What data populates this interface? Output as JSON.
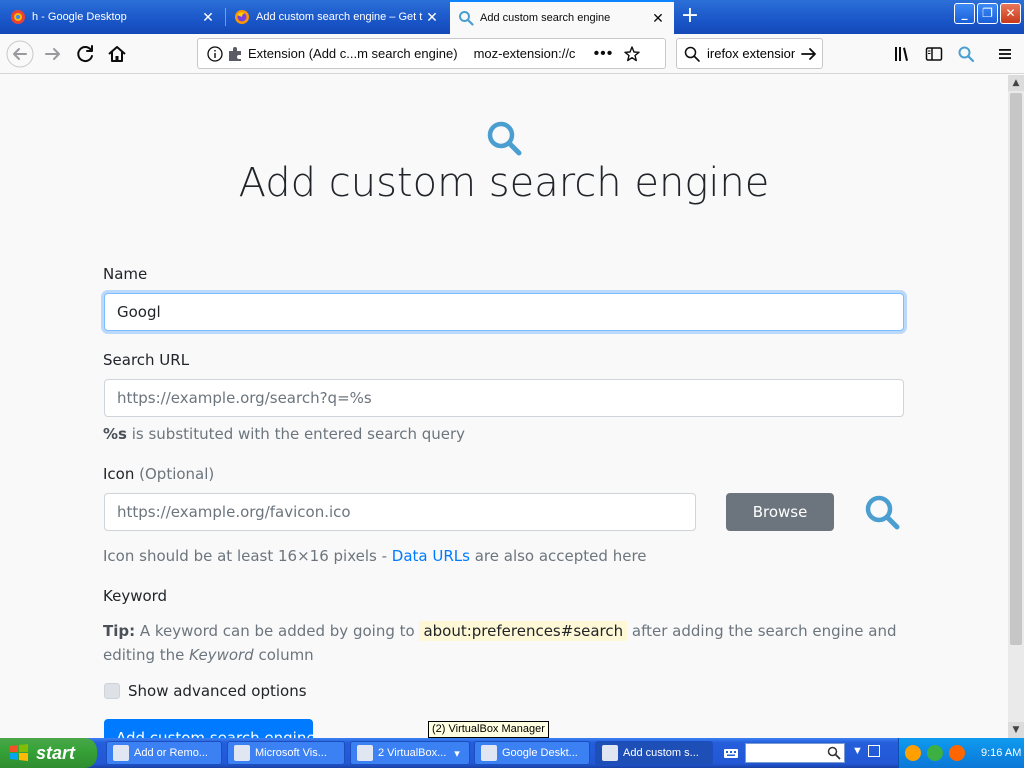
{
  "tabs": [
    {
      "title": "h - Google Desktop",
      "active": false,
      "favicon": "google-desktop-icon"
    },
    {
      "title": "Add custom search engine – Get t",
      "active": false,
      "favicon": "firefox-icon"
    },
    {
      "title": "Add custom search engine",
      "active": true,
      "favicon": "search-icon"
    }
  ],
  "window_buttons": {
    "minimize": "_",
    "maximize": "❐",
    "close": "✕"
  },
  "toolbar": {
    "url_identity": "Extension (Add c...m search engine)",
    "url": "moz-extension://c",
    "search_value": "irefox extension"
  },
  "page": {
    "title": "Add custom search engine",
    "name_label": "Name",
    "name_value": "Googl",
    "search_url_label": "Search URL",
    "search_url_placeholder": "https://example.org/search?q=%s",
    "search_url_help_code": "%s",
    "search_url_help_text": " is substituted with the entered search query",
    "icon_label": "Icon",
    "icon_optional": "(Optional)",
    "icon_placeholder": "https://example.org/favicon.ico",
    "browse_label": "Browse",
    "icon_help_prefix": "Icon should be at least 16×16 pixels - ",
    "icon_help_link": "Data URLs",
    "icon_help_suffix": " are also accepted here",
    "keyword_label": "Keyword",
    "tip_label": "Tip:",
    "tip_text_1": " A keyword can be added by going to ",
    "tip_code": "about:preferences#search",
    "tip_text_2": " after adding the search engine and editing the ",
    "tip_italic": "Keyword",
    "tip_text_3": " column",
    "advanced_label": "Show advanced options",
    "submit_label": "Add custom search engine"
  },
  "tooltip": "(2) VirtualBox Manager",
  "taskbar": {
    "start_label": "start",
    "tasks": [
      {
        "label": "Add or Remo...",
        "active": false
      },
      {
        "label": "Microsoft Vis...",
        "active": false
      },
      {
        "label": "2 VirtualBox...",
        "active": false
      },
      {
        "label": "Google Deskt...",
        "active": false
      },
      {
        "label": "Add custom s...",
        "active": true
      }
    ],
    "clock": "9:16 AM"
  },
  "colors": {
    "accent": "#0a84ff",
    "primary_button": "#007bff",
    "secondary_button": "#6c757d",
    "icon_blue": "#4a9fd0"
  }
}
